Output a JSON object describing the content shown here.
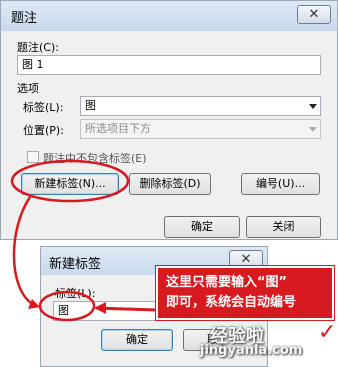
{
  "caption_dialog": {
    "title": "题注",
    "close_glyph": "✕",
    "caption_label": "题注(C):",
    "caption_value": "图 1",
    "options_label": "选项",
    "tag_label": "标签(L):",
    "tag_value": "图",
    "position_label": "位置(P):",
    "position_value": "所选项目下方",
    "exclude_label": "题注中不包含标签(E)",
    "new_label_button": "新建标签(N)...",
    "delete_label_button": "删除标签(D)",
    "numbering_button": "编号(U)...",
    "ok_button": "确定",
    "close_button": "关闭"
  },
  "new_label_dialog": {
    "title": "新建标签",
    "close_glyph": "✕",
    "label_field_label": "标签(L):",
    "label_value": "图",
    "ok_button": "确定",
    "cancel_button_partial": "取"
  },
  "annotation": {
    "line1": "这里只需要输入“图”",
    "line2": "即可，系统会自动编号",
    "color": "#d71920"
  },
  "watermark": {
    "line1": "经验啦",
    "line2": "jingyanla.com",
    "check_glyph": "✓"
  }
}
